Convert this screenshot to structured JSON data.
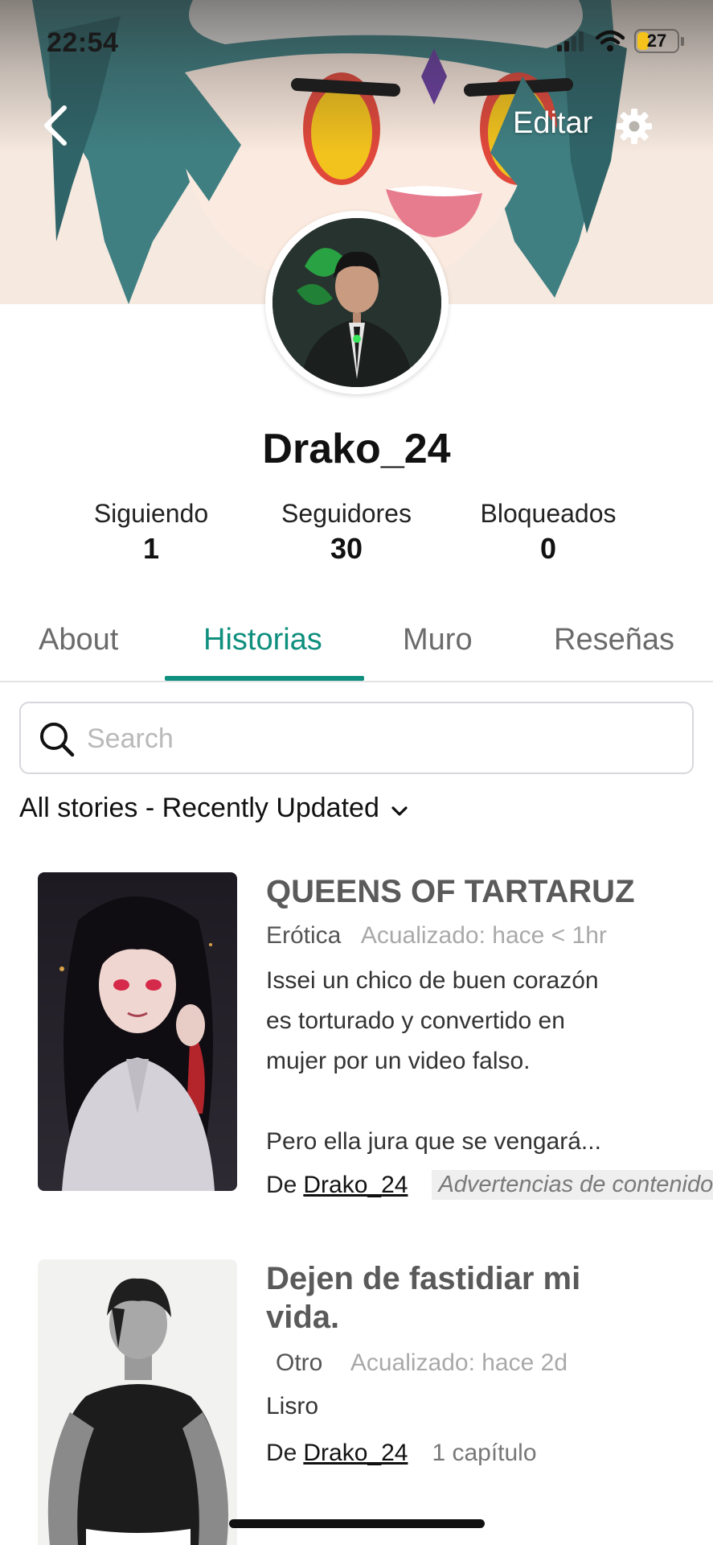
{
  "status_bar": {
    "time": "22:54",
    "battery": "27"
  },
  "header": {
    "edit_label": "Editar"
  },
  "profile": {
    "username": "Drako_24"
  },
  "stats": [
    {
      "label": "Siguiendo",
      "value": "1"
    },
    {
      "label": "Seguidores",
      "value": "30"
    },
    {
      "label": "Bloqueados",
      "value": "0"
    }
  ],
  "tabs": [
    {
      "label": "About",
      "active": false
    },
    {
      "label": "Historias",
      "active": true
    },
    {
      "label": "Muro",
      "active": false
    },
    {
      "label": "Reseñas",
      "active": false
    }
  ],
  "search": {
    "placeholder": "Search"
  },
  "filter": {
    "label": "All stories - Recently Updated"
  },
  "stories": [
    {
      "title": "QUEENS OF TARTARUZ",
      "genre": "Erótica",
      "updated": "Acualizado: hace < 1hr",
      "description": "Issei un chico de buen corazón\nes torturado y convertido en\nmujer por un video falso.\n\nPero ella jura que se vengará...",
      "author_prefix": "De",
      "author": "Drako_24",
      "tag": "Advertencias de contenido"
    },
    {
      "title": "Dejen de fastidiar mi vida.",
      "genre": "Otro",
      "updated": "Acualizado: hace 2d",
      "description": "Lisro",
      "author_prefix": "De",
      "author": "Drako_24",
      "chapters": "1 capítulo"
    }
  ],
  "colors": {
    "accent": "#0f8f7e",
    "battery": "#f4c21b"
  },
  "icons": [
    "back-arrow-icon",
    "gear-icon",
    "search-icon",
    "chevron-down-icon",
    "wifi-icon",
    "signal-icon",
    "battery-icon"
  ]
}
